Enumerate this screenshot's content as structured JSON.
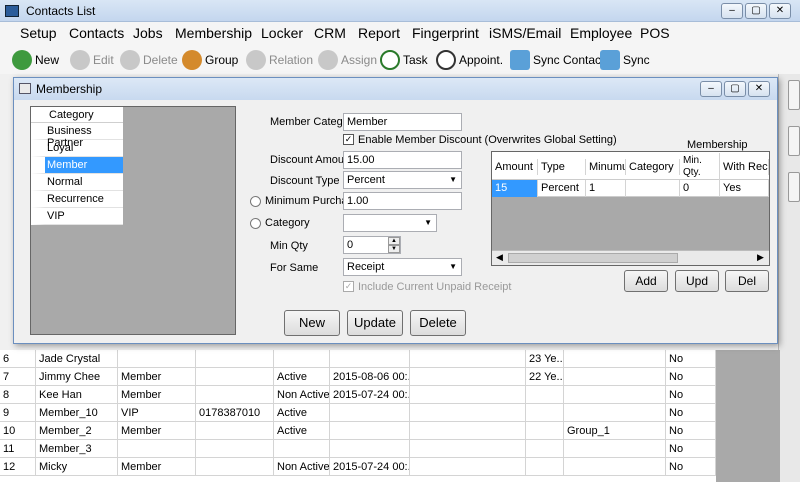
{
  "window": {
    "title": "Contacts List",
    "min": "–",
    "max": "▢",
    "close": "✕"
  },
  "menu": [
    "Setup",
    "Contacts",
    "Jobs",
    "Membership",
    "Locker",
    "CRM",
    "Report",
    "Fingerprint",
    "iSMS/Email",
    "Employee",
    "POS"
  ],
  "toolbar": {
    "new": "New",
    "edit": "Edit",
    "delete": "Delete",
    "group": "Group",
    "relation": "Relation",
    "assign": "Assign",
    "task": "Task",
    "appoint": "Appoint.",
    "sync_contact": "Sync Contact",
    "sync": "Sync"
  },
  "grid_rows": [
    {
      "no": "6",
      "name": "Jade Crystal",
      "category": "",
      "phone": "",
      "status": "",
      "date": "",
      "extra": "",
      "age": "23 Ye...",
      "group": "",
      "flag": "No"
    },
    {
      "no": "7",
      "name": "Jimmy Chee",
      "category": "Member",
      "phone": "",
      "status": "Active",
      "date": "2015-08-06 00:...",
      "extra": "",
      "age": "22 Ye...",
      "group": "",
      "flag": "No"
    },
    {
      "no": "8",
      "name": "Kee Han",
      "category": "Member",
      "phone": "",
      "status": "Non Active",
      "date": "2015-07-24 00:...",
      "extra": "",
      "age": "",
      "group": "",
      "flag": "No"
    },
    {
      "no": "9",
      "name": "Member_10",
      "category": "VIP",
      "phone": "0178387010",
      "status": "Active",
      "date": "",
      "extra": "",
      "age": "",
      "group": "",
      "flag": "No"
    },
    {
      "no": "10",
      "name": "Member_2",
      "category": "Member",
      "phone": "",
      "status": "Active",
      "date": "",
      "extra": "",
      "age": "",
      "group": "Group_1",
      "flag": "No"
    },
    {
      "no": "11",
      "name": "Member_3",
      "category": "",
      "phone": "",
      "status": "",
      "date": "",
      "extra": "",
      "age": "",
      "group": "",
      "flag": "No"
    },
    {
      "no": "12",
      "name": "Micky",
      "category": "Member",
      "phone": "",
      "status": "Non Active",
      "date": "2015-07-24 00:...",
      "extra": "",
      "age": "",
      "group": "",
      "flag": "No"
    }
  ],
  "dialog": {
    "title": "Membership",
    "category_header": "Category",
    "categories": [
      "Business Partner",
      "Loyal",
      "Member",
      "Normal",
      "Recurrence",
      "VIP"
    ],
    "selected_category": "Member",
    "member_category_label": "Member Category",
    "member_category_value": "Member",
    "enable_discount_label": "Enable Member Discount (Overwrites Global Setting)",
    "discount_amount_label": "Discount Amount",
    "discount_amount_value": "15.00",
    "discount_type_label": "Discount Type",
    "discount_type_value": "Percent",
    "min_purchase_label": "Minimum Purchase",
    "min_purchase_value": "1.00",
    "category_label": "Category",
    "category_value": "",
    "min_qty_label": "Min Qty",
    "min_qty_value": "0",
    "for_same_label": "For Same",
    "for_same_value": "Receipt",
    "include_unpaid_label": "Include Current Unpaid Receipt",
    "md_title": "Membership Discount",
    "md_headers": [
      "Amount",
      "Type",
      "Minumun",
      "Category",
      "Min. Qty.",
      "With Receip"
    ],
    "md_row": [
      "15",
      "Percent",
      "1",
      "",
      "0",
      "Yes"
    ],
    "add": "Add",
    "upd": "Upd",
    "del": "Del",
    "new": "New",
    "update": "Update",
    "delete": "Delete"
  }
}
